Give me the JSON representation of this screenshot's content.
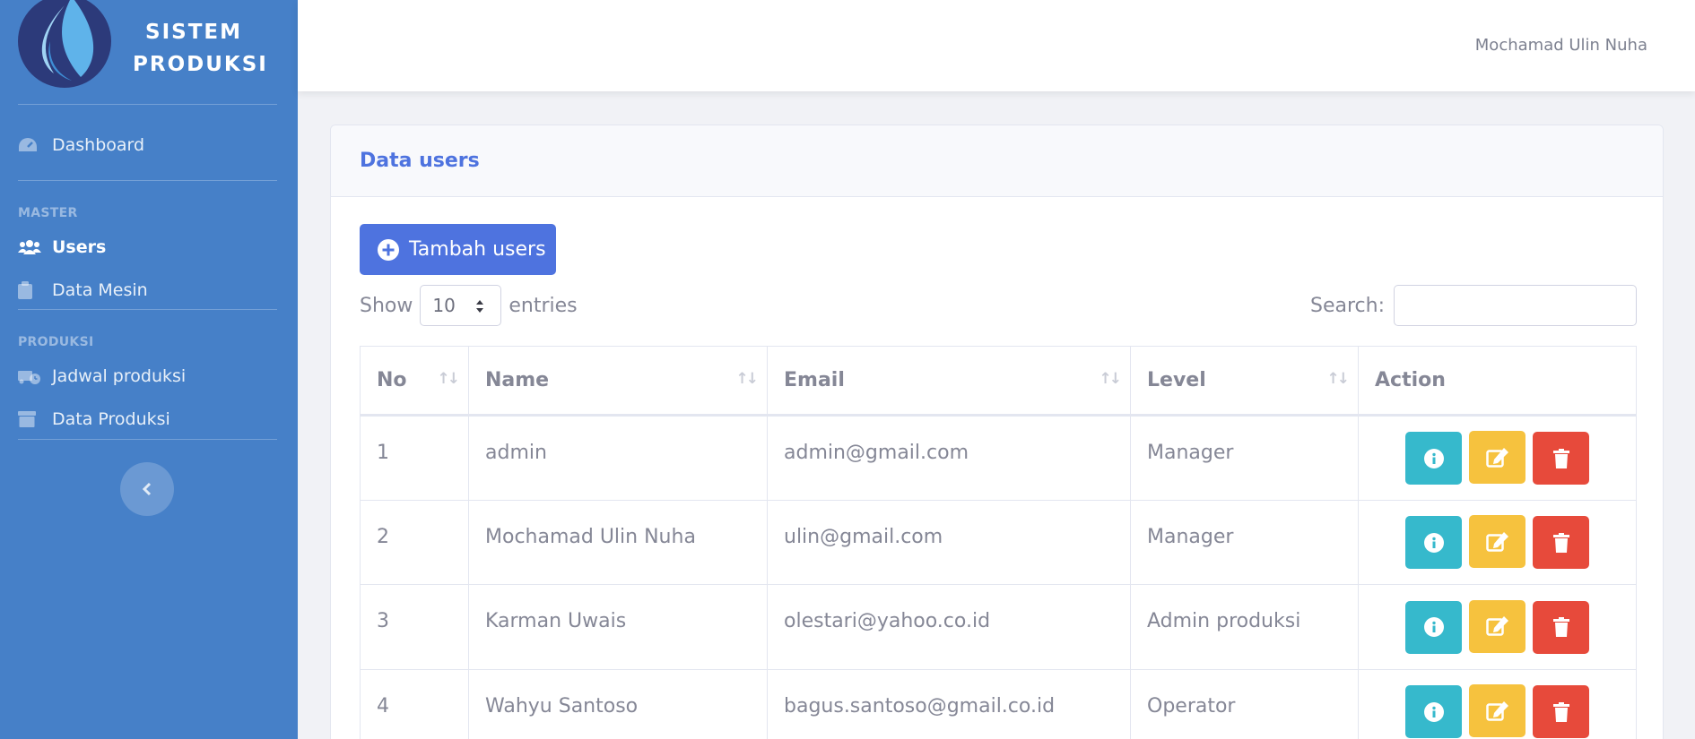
{
  "brand": {
    "line1": "SISTEM",
    "line2": "PRODUKSI"
  },
  "sidebar": {
    "dashboard": {
      "label": "Dashboard",
      "icon": "tachometer-icon"
    },
    "heading_master": "MASTER",
    "users": {
      "label": "Users",
      "icon": "users-icon"
    },
    "data_mesin": {
      "label": "Data Mesin",
      "icon": "clipboard-icon"
    },
    "heading_produksi": "PRODUKSI",
    "jadwal": {
      "label": "Jadwal produksi",
      "icon": "truck-clock-icon"
    },
    "data_produksi": {
      "label": "Data Produksi",
      "icon": "archive-icon"
    },
    "toggle_icon": "chevron-left-icon"
  },
  "topbar": {
    "user_name": "Mochamad Ulin Nuha"
  },
  "card": {
    "title": "Data users",
    "add_button": "Tambah users",
    "show_label": "Show",
    "entries_value": "10",
    "entries_label": "entries",
    "search_label": "Search:",
    "search_value": ""
  },
  "table": {
    "columns": [
      "No",
      "Name",
      "Email",
      "Level",
      "Action"
    ],
    "rows": [
      {
        "no": "1",
        "name": "admin",
        "email": "admin@gmail.com",
        "level": "Manager"
      },
      {
        "no": "2",
        "name": "Mochamad Ulin Nuha",
        "email": "ulin@gmail.com",
        "level": "Manager"
      },
      {
        "no": "3",
        "name": "Karman Uwais",
        "email": "olestari@yahoo.co.id",
        "level": "Admin produksi"
      },
      {
        "no": "4",
        "name": "Wahyu Santoso",
        "email": "bagus.santoso@gmail.co.id",
        "level": "Operator"
      }
    ]
  },
  "colors": {
    "sidebar": "#4680c8",
    "primary": "#4e73df",
    "info": "#36b9cc",
    "warning": "#f6c23e",
    "danger": "#e74a3b"
  }
}
